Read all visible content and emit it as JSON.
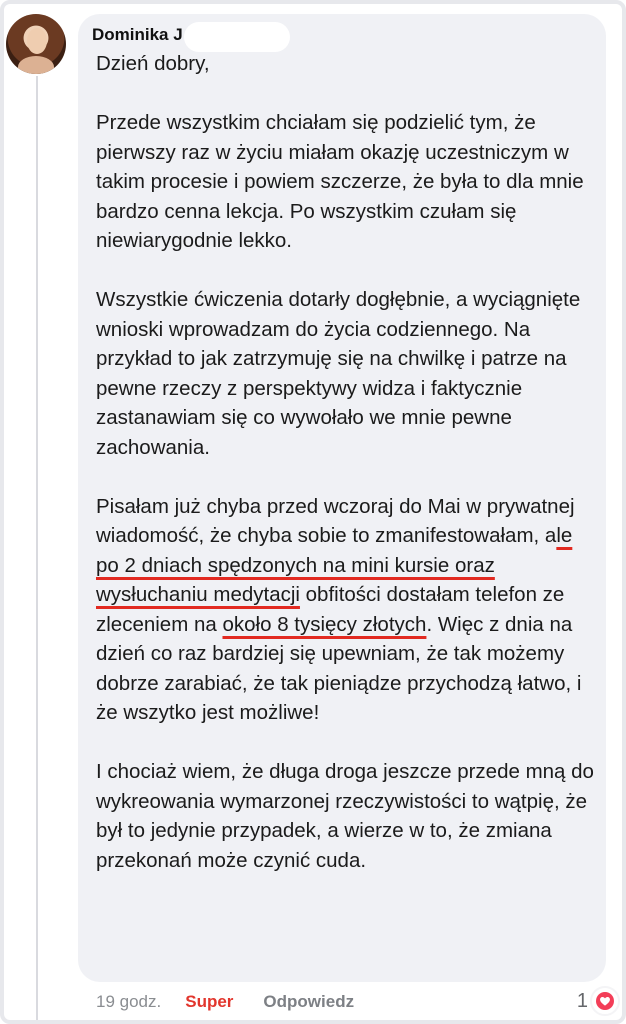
{
  "comment": {
    "author": "Dominika J",
    "paragraphs": [
      [
        {
          "text": "Dzień dobry,",
          "underline": false
        }
      ],
      [
        {
          "text": "Przede wszystkim chciałam się podzielić tym, że pierwszy raz w życiu miałam okazję uczestniczym w takim procesie i powiem szczerze, że była to dla mnie bardzo cenna lekcja. Po wszystkim czułam się niewiarygodnie lekko.",
          "underline": false
        }
      ],
      [
        {
          "text": "Wszystkie ćwiczenia dotarły dogłębnie, a wyciągnięte wnioski wprowadzam do życia codziennego. Na przykład to jak zatrzymuję się na chwilkę i patrze na pewne rzeczy z perspektywy widza i faktycznie zastanawiam się co wywołało we mnie pewne zachowania.",
          "underline": false
        }
      ],
      [
        {
          "text": "Pisałam już chyba przed wczoraj do Mai w prywatnej wiadomość, że chyba sobie to zmanifestowałam, a",
          "underline": false
        },
        {
          "text": "le po 2 dniach spędzonych na mini kursie oraz wysłuchaniu medytacji",
          "underline": true
        },
        {
          "text": " obfitości dostałam telefon ze zleceniem na ",
          "underline": false
        },
        {
          "text": "około 8 tysięcy złotych",
          "underline": true
        },
        {
          "text": ". Więc z dnia na dzień co raz bardziej się upewniam, że tak możemy dobrze zarabiać, że tak pieniądze przychodzą łatwo, i że wszytko jest możliwe!",
          "underline": false
        }
      ],
      [
        {
          "text": "I chociaż wiem, że długa droga jeszcze przede mną do wykreowania wymarzonej rzeczywistości to wątpię, że był to jedynie przypadek, a wierze w to, że zmiana przekonań może czynić cuda.",
          "underline": false
        }
      ]
    ],
    "meta": {
      "time": "19 godz.",
      "reaction_label": "Super",
      "reply_label": "Odpowiedz"
    },
    "reactions": {
      "count": "1",
      "icon": "heart-icon"
    }
  },
  "colors": {
    "bubble": "#f0f1f5",
    "underline": "#e22a21",
    "reaction_red": "#e2362d"
  }
}
